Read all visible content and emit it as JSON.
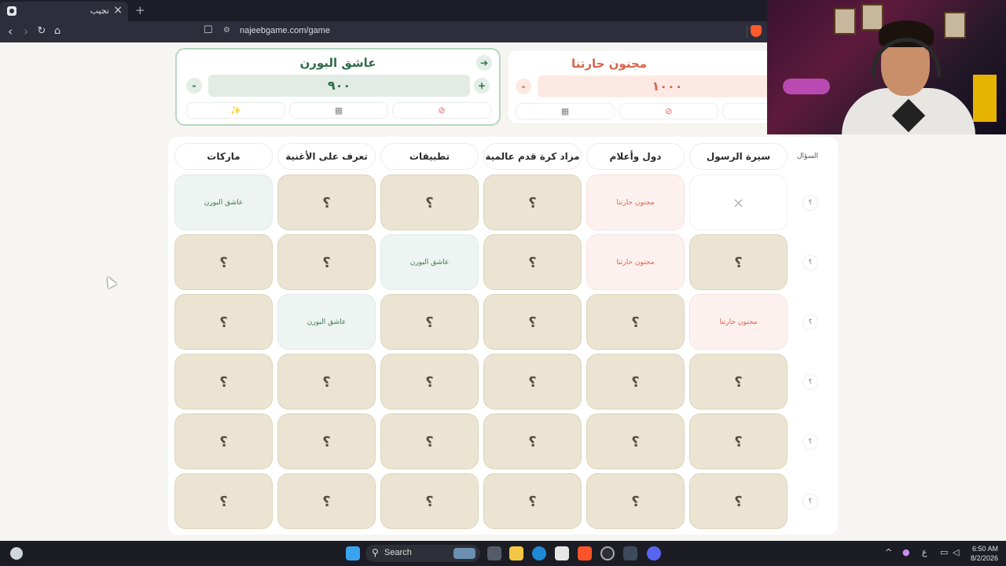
{
  "browser": {
    "tab_title": "نجيب",
    "tab_close": "×",
    "new_tab": "+",
    "url": "najeebgame.com/game",
    "back": "‹",
    "forward": "›",
    "reload": "↻",
    "home": "⌂",
    "bookmark": "☐"
  },
  "teams": [
    {
      "name": "عاشق البورن",
      "score": "٩٠٠",
      "minus": "-",
      "plus": "+",
      "arrow": "➔",
      "tools": [
        "✨",
        "▦",
        "⊘"
      ]
    },
    {
      "name": "مجنون حارتنا",
      "score": "١٠٠٠",
      "minus": "-",
      "tools": [
        "▦",
        "⊘",
        ""
      ]
    }
  ],
  "board": {
    "question_label": "السؤال",
    "row_marker": "؟",
    "cell_unopened": "؟",
    "cell_empty": "×",
    "categories": [
      "سيرة الرسول",
      "دول وأعلام",
      "مزاد كرة قدم عالمية",
      "تطبيقات",
      "تعرف على الأغنية",
      "ماركات"
    ],
    "rows": [
      [
        {
          "s": "empty"
        },
        {
          "s": "red",
          "t": "مجنون حارتنا"
        },
        {
          "s": "q"
        },
        {
          "s": "q"
        },
        {
          "s": "q"
        },
        {
          "s": "green",
          "t": "عاشق البورن"
        }
      ],
      [
        {
          "s": "q"
        },
        {
          "s": "red",
          "t": "مجنون حارتنا"
        },
        {
          "s": "q"
        },
        {
          "s": "green",
          "t": "عاشق البورن"
        },
        {
          "s": "q"
        },
        {
          "s": "q"
        }
      ],
      [
        {
          "s": "red",
          "t": "مجنون حارتنا"
        },
        {
          "s": "q"
        },
        {
          "s": "q"
        },
        {
          "s": "q"
        },
        {
          "s": "green",
          "t": "عاشق البورن"
        },
        {
          "s": "q"
        }
      ],
      [
        {
          "s": "q"
        },
        {
          "s": "q"
        },
        {
          "s": "q"
        },
        {
          "s": "q"
        },
        {
          "s": "q"
        },
        {
          "s": "q"
        }
      ],
      [
        {
          "s": "q"
        },
        {
          "s": "q"
        },
        {
          "s": "q"
        },
        {
          "s": "q"
        },
        {
          "s": "q"
        },
        {
          "s": "q"
        }
      ],
      [
        {
          "s": "q"
        },
        {
          "s": "q"
        },
        {
          "s": "q"
        },
        {
          "s": "q"
        },
        {
          "s": "q"
        },
        {
          "s": "q"
        }
      ]
    ]
  },
  "taskbar": {
    "search_label": "Search",
    "search_icon": "⚲",
    "time": "6:50 AM",
    "date": "8/2/2026",
    "lang": "ع",
    "chevron": "^"
  },
  "colors": {
    "team_green": "#2f6b4a",
    "team_red": "#d9634b",
    "cell_unopened": "#ebe4d2"
  }
}
